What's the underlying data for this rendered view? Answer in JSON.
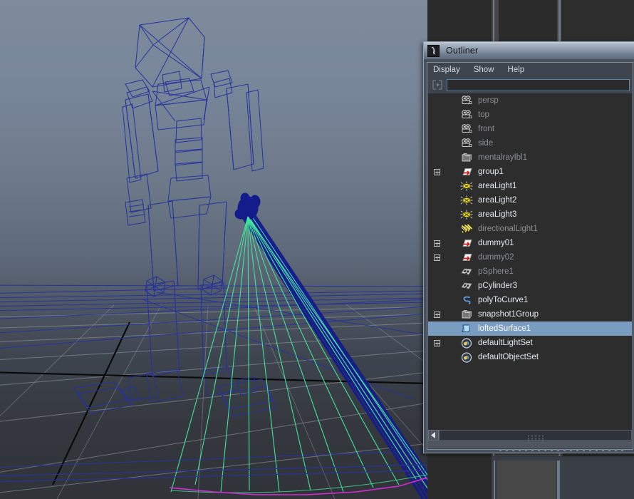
{
  "window": {
    "title": "Outliner",
    "title_icon": "maya-outliner-icon",
    "menus": [
      {
        "label": "Display",
        "name": "menu-display"
      },
      {
        "label": "Show",
        "name": "menu-show"
      },
      {
        "label": "Help",
        "name": "menu-help"
      }
    ],
    "search": {
      "value": "",
      "placeholder": "",
      "filter_icon": "filter-icon"
    },
    "scrollbar": {
      "left_arrow_icon": "arrow-left-icon",
      "grip_icon": "grip-dots-icon"
    },
    "colors": {
      "selection": "#7a9cc0",
      "list_bg": "#2d2d2d",
      "panel_bg": "#3f454f",
      "titlebar_top": "#c4ccd6",
      "titlebar_bottom": "#5d6b7d",
      "border": "#8fa2b5"
    }
  },
  "outliner_items": [
    {
      "label": "persp",
      "icon": "camera-icon",
      "indent": 0,
      "expander": false,
      "dim": true,
      "selected": false
    },
    {
      "label": "top",
      "icon": "camera-icon",
      "indent": 0,
      "expander": false,
      "dim": true,
      "selected": false
    },
    {
      "label": "front",
      "icon": "camera-icon",
      "indent": 0,
      "expander": false,
      "dim": true,
      "selected": false
    },
    {
      "label": "side",
      "icon": "camera-icon",
      "indent": 0,
      "expander": false,
      "dim": true,
      "selected": false
    },
    {
      "label": "mentalrayIbl1",
      "icon": "folder-icon",
      "indent": 0,
      "expander": false,
      "dim": true,
      "selected": false
    },
    {
      "label": "group1",
      "icon": "group-icon",
      "indent": 0,
      "expander": true,
      "dim": false,
      "selected": false
    },
    {
      "label": "areaLight1",
      "icon": "area-light-icon",
      "indent": 0,
      "expander": false,
      "dim": false,
      "selected": false
    },
    {
      "label": "areaLight2",
      "icon": "area-light-icon",
      "indent": 0,
      "expander": false,
      "dim": false,
      "selected": false
    },
    {
      "label": "areaLight3",
      "icon": "area-light-icon",
      "indent": 0,
      "expander": false,
      "dim": false,
      "selected": false
    },
    {
      "label": "directionalLight1",
      "icon": "directional-light-icon",
      "indent": 0,
      "expander": false,
      "dim": true,
      "selected": false
    },
    {
      "label": "dummy01",
      "icon": "group-icon",
      "indent": 0,
      "expander": true,
      "dim": false,
      "selected": false
    },
    {
      "label": "dummy02",
      "icon": "group-icon",
      "indent": 0,
      "expander": true,
      "dim": true,
      "selected": false
    },
    {
      "label": "pSphere1",
      "icon": "mesh-icon",
      "indent": 0,
      "expander": false,
      "dim": true,
      "selected": false
    },
    {
      "label": "pCylinder3",
      "icon": "mesh-icon",
      "indent": 0,
      "expander": false,
      "dim": false,
      "selected": false
    },
    {
      "label": "polyToCurve1",
      "icon": "curve-icon",
      "indent": 0,
      "expander": false,
      "dim": false,
      "selected": false
    },
    {
      "label": "snapshot1Group",
      "icon": "folder-icon",
      "indent": 0,
      "expander": true,
      "dim": false,
      "selected": false
    },
    {
      "label": "loftedSurface1",
      "icon": "surface-icon",
      "indent": 0,
      "expander": false,
      "dim": false,
      "selected": true
    },
    {
      "label": "defaultLightSet",
      "icon": "set-icon",
      "indent": 0,
      "expander": true,
      "dim": false,
      "selected": false
    },
    {
      "label": "defaultObjectSet",
      "icon": "set-icon",
      "indent": 0,
      "expander": false,
      "dim": false,
      "selected": false
    }
  ],
  "viewport": {
    "name": "perspective-viewport",
    "background_top": "#7e8b9c",
    "background_bottom": "#303338",
    "wireframe_color": "#1f2a8c",
    "selected_color": "#1a1f9e",
    "lofted_surface_color": "#44e39a",
    "curve_color": "#d72ad7",
    "grid_color": "#9aa1a8",
    "axis_color": "#0a0a0a",
    "objects": [
      {
        "name": "character-wireframe",
        "type": "mesh-wireframe"
      },
      {
        "name": "lofted-surface-fan",
        "type": "nurbs-surface"
      },
      {
        "name": "ground-grid",
        "type": "grid"
      },
      {
        "name": "poly-to-curve",
        "type": "curve"
      }
    ]
  }
}
